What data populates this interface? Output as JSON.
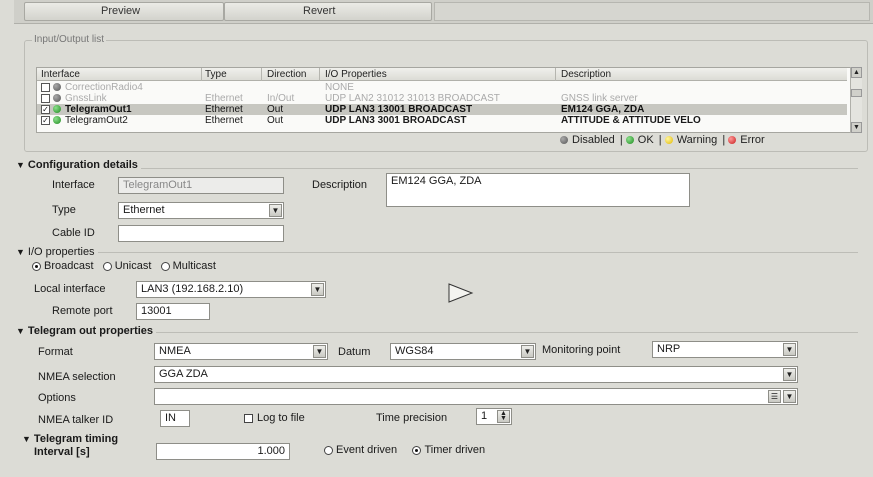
{
  "toolbar": {
    "preview": "Preview",
    "revert": "Revert"
  },
  "io_list": {
    "title": "Input/Output list",
    "columns": [
      "Interface",
      "Type",
      "Direction",
      "I/O Properties",
      "Description"
    ],
    "rows": [
      {
        "checked": false,
        "status": "disabled",
        "interface": "CorrectionRadio4",
        "type": "",
        "direction": "",
        "props": "NONE",
        "desc": ""
      },
      {
        "checked": false,
        "status": "disabled",
        "interface": "GnssLink",
        "type": "Ethernet",
        "direction": "In/Out",
        "props": "UDP LAN2 31012 31013 BROADCAST",
        "desc": "GNSS link server"
      },
      {
        "checked": true,
        "status": "ok",
        "interface": "TelegramOut1",
        "type": "Ethernet",
        "direction": "Out",
        "props": "UDP LAN3 13001 BROADCAST",
        "desc": "EM124 GGA, ZDA"
      },
      {
        "checked": true,
        "status": "ok",
        "interface": "TelegramOut2",
        "type": "Ethernet",
        "direction": "Out",
        "props": "UDP LAN3 3001 BROADCAST",
        "desc": "ATTITUDE & ATTITUDE VELO"
      }
    ]
  },
  "legend": {
    "disabled": "Disabled",
    "ok": "OK",
    "warning": "Warning",
    "error": "Error",
    "sep": "|"
  },
  "config": {
    "title": "Configuration details",
    "interface_label": "Interface",
    "interface_value": "TelegramOut1",
    "description_label": "Description",
    "description_value": "EM124 GGA, ZDA",
    "type_label": "Type",
    "type_value": "Ethernet",
    "cable_label": "Cable ID",
    "cable_value": ""
  },
  "io_props": {
    "title": "I/O properties",
    "broadcast": "Broadcast",
    "unicast": "Unicast",
    "multicast": "Multicast",
    "local_if_label": "Local interface",
    "local_if_value": "LAN3 (192.168.2.10)",
    "remote_port_label": "Remote port",
    "remote_port_value": "13001"
  },
  "telegram": {
    "title": "Telegram out properties",
    "format_label": "Format",
    "format_value": "NMEA",
    "datum_label": "Datum",
    "datum_value": "WGS84",
    "mon_label": "Monitoring point",
    "mon_value": "NRP",
    "nmea_sel_label": "NMEA selection",
    "nmea_sel_value": "GGA ZDA",
    "options_label": "Options",
    "options_value": "",
    "talker_label": "NMEA talker ID",
    "talker_value": "IN",
    "log_label": "Log to file",
    "time_prec_label": "Time precision",
    "time_prec_value": "1"
  },
  "timing": {
    "title": "Telegram timing",
    "interval_label": "Interval [s]",
    "interval_value": "1.000",
    "event": "Event driven",
    "timer": "Timer driven"
  }
}
